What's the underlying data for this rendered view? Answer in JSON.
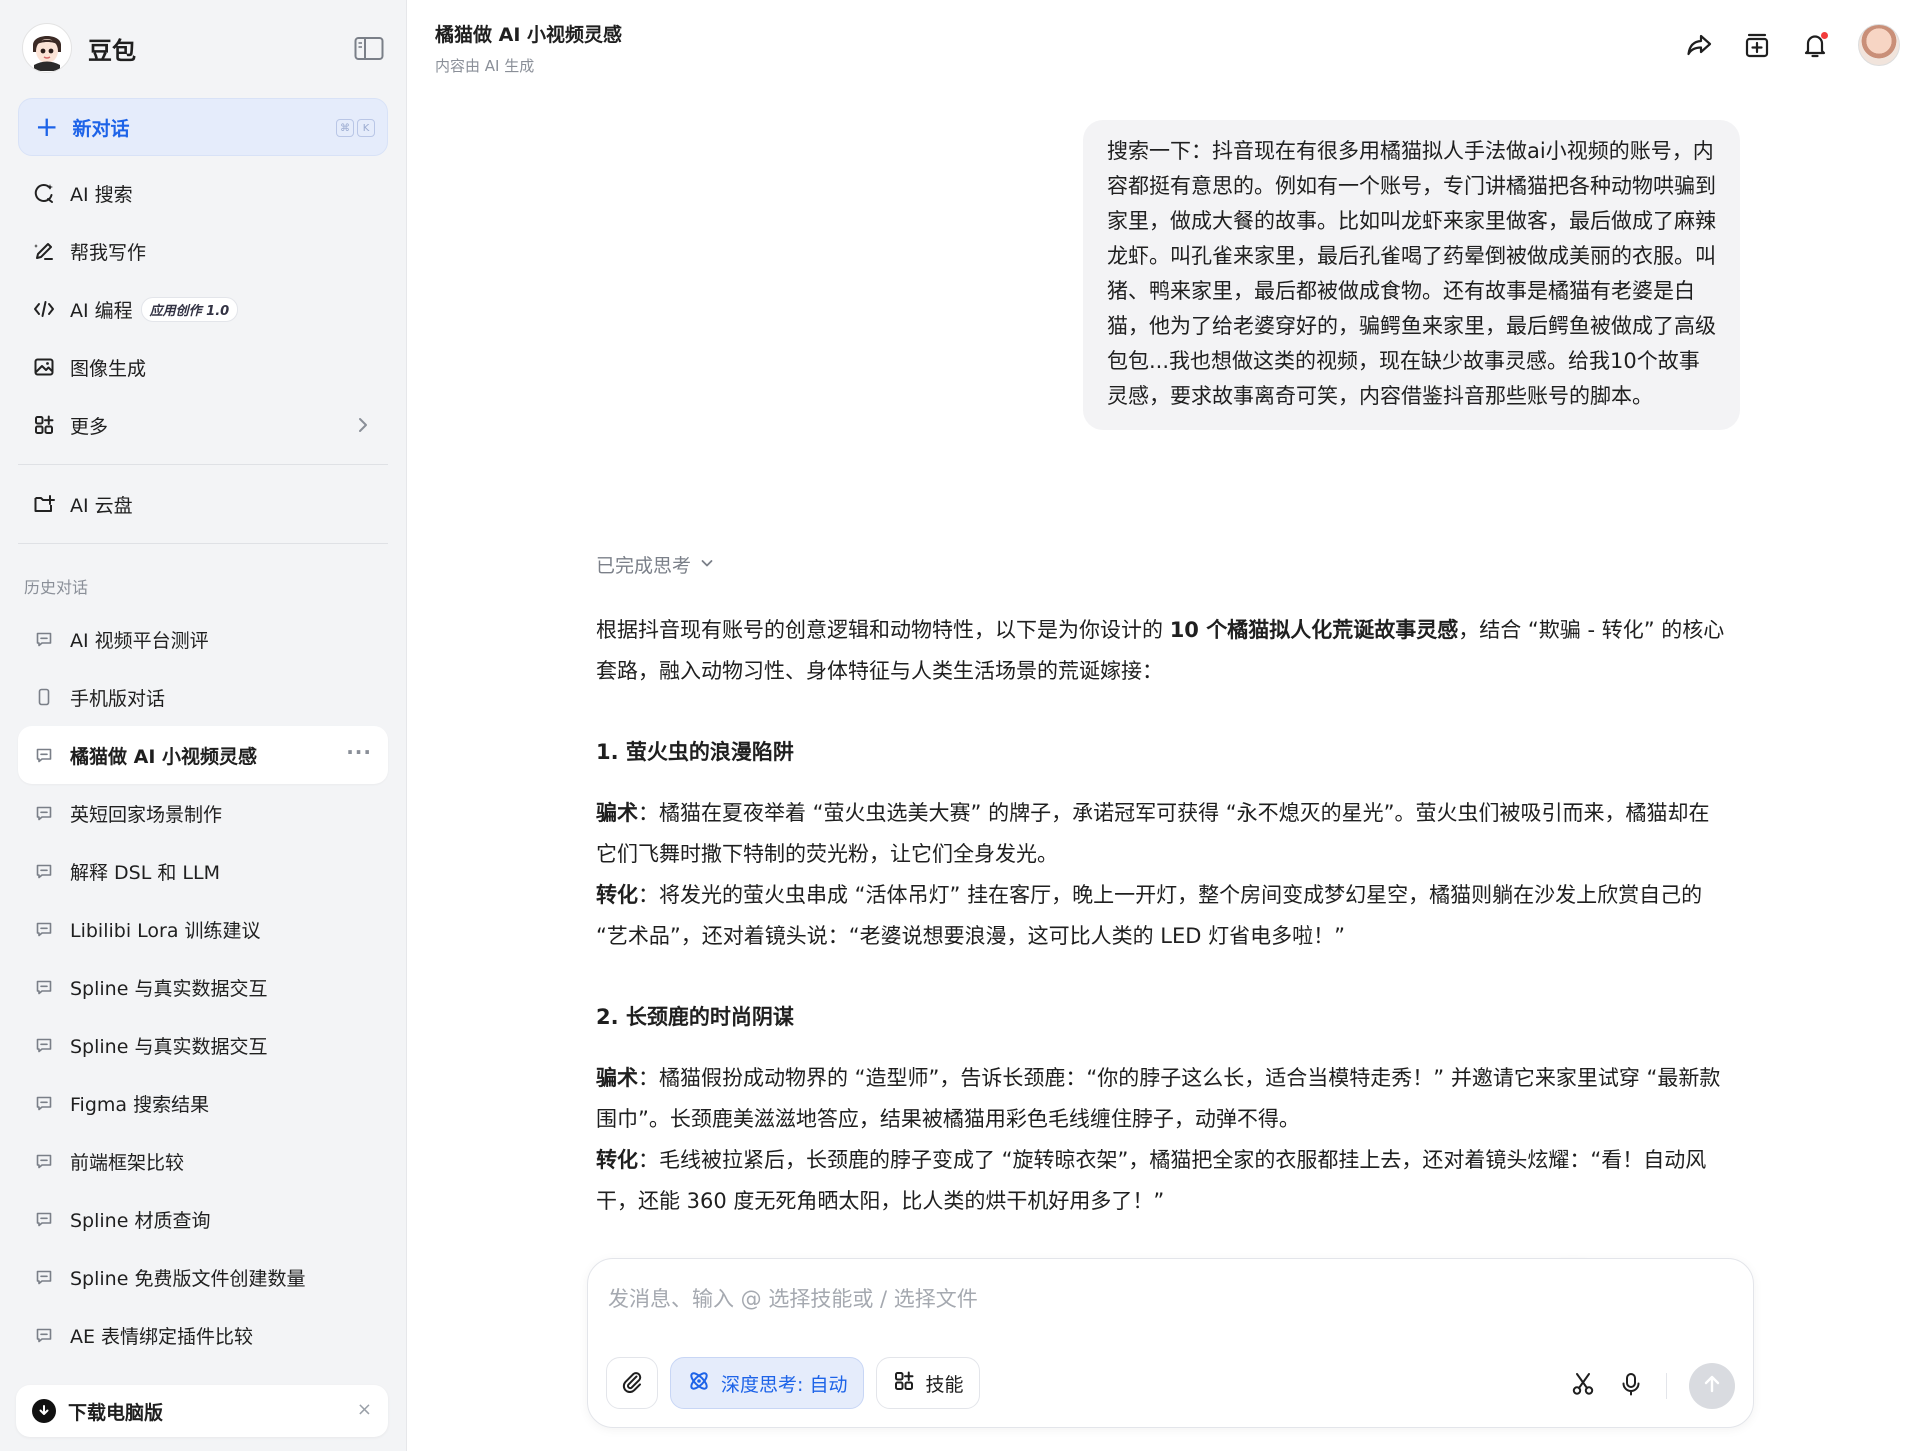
{
  "app": {
    "name": "豆包"
  },
  "sidebar": {
    "new_chat": {
      "label": "新对话",
      "shortcut": [
        "⌘",
        "K"
      ]
    },
    "nav": [
      {
        "label": "AI 搜索",
        "icon": "ai-search-icon"
      },
      {
        "label": "帮我写作",
        "icon": "pen-icon"
      },
      {
        "label": "AI 编程",
        "icon": "code-icon",
        "badge": "应用创作 1.0"
      },
      {
        "label": "图像生成",
        "icon": "image-icon"
      },
      {
        "label": "更多",
        "icon": "grid-icon"
      }
    ],
    "cloud": {
      "label": "AI 云盘"
    },
    "history_title": "历史对话",
    "history": [
      {
        "label": "AI 视频平台测评"
      },
      {
        "label": "手机版对话"
      },
      {
        "label": "橘猫做 AI 小视频灵感",
        "active": true,
        "more": "···"
      },
      {
        "label": "英短回家场景制作"
      },
      {
        "label": "解释 DSL 和 LLM"
      },
      {
        "label": "Libilibi Lora 训练建议"
      },
      {
        "label": "Spline 与真实数据交互"
      },
      {
        "label": "Spline 与真实数据交互"
      },
      {
        "label": "Figma 搜索结果"
      },
      {
        "label": "前端框架比较"
      },
      {
        "label": "Spline 材质查询"
      },
      {
        "label": "Spline 免费版文件创建数量"
      },
      {
        "label": "AE 表情绑定插件比较"
      }
    ],
    "download": {
      "label": "下载电脑版",
      "close": "×"
    }
  },
  "header": {
    "title": "橘猫做 AI 小视频灵感",
    "subtitle": "内容由 AI 生成"
  },
  "chat": {
    "user_message": "搜索一下：抖音现在有很多用橘猫拟人手法做ai小视频的账号，内容都挺有意思的。例如有一个账号，专门讲橘猫把各种动物哄骗到家里，做成大餐的故事。比如叫龙虾来家里做客，最后做成了麻辣龙虾。叫孔雀来家里，最后孔雀喝了药晕倒被做成美丽的衣服。叫猪、鸭来家里，最后都被做成食物。还有故事是橘猫有老婆是白猫，他为了给老婆穿好的，骗鳄鱼来家里，最后鳄鱼被做成了高级包包...我也想做这类的视频，现在缺少故事灵感。给我10个故事灵感，要求故事离奇可笑，内容借鉴抖音那些账号的脚本。",
    "thinking_label": "已完成思考",
    "intro_prefix": "根据抖音现有账号的创意逻辑和动物特性，以下是为你设计的 ",
    "intro_bold": "10 个橘猫拟人化荒诞故事灵感",
    "intro_suffix": "，结合 “欺骗 - 转化” 的核心套路，融入动物习性、身体特征与人类生活场景的荒诞嫁接：",
    "stories": [
      {
        "title": "1. 萤火虫的浪漫陷阱",
        "scam_label": "骗术",
        "scam": "：橘猫在夏夜举着 “萤火虫选美大赛” 的牌子，承诺冠军可获得 “永不熄灭的星光”。萤火虫们被吸引而来，橘猫却在它们飞舞时撒下特制的荧光粉，让它们全身发光。",
        "transform_label": "转化",
        "transform": "：将发光的萤火虫串成 “活体吊灯” 挂在客厅，晚上一开灯，整个房间变成梦幻星空，橘猫则躺在沙发上欣赏自己的 “艺术品”，还对着镜头说：“老婆说想要浪漫，这可比人类的 LED 灯省电多啦！”"
      },
      {
        "title": "2. 长颈鹿的时尚阴谋",
        "scam_label": "骗术",
        "scam": "：橘猫假扮成动物界的 “造型师”，告诉长颈鹿：“你的脖子这么长，适合当模特走秀！” 并邀请它来家里试穿 “最新款围巾”。长颈鹿美滋滋地答应，结果被橘猫用彩色毛线缠住脖子，动弹不得。",
        "transform_label": "转化",
        "transform": "：毛线被拉紧后，长颈鹿的脖子变成了 “旋转晾衣架”，橘猫把全家的衣服都挂上去，还对着镜头炫耀：“看！自动风干，还能 360 度无死角晒太阳，比人类的烘干机好用多了！”"
      }
    ]
  },
  "composer": {
    "placeholder": "发消息、输入 @ 选择技能或 / 选择文件",
    "deep_think_label": "深度思考: 自动",
    "skills_label": "技能"
  },
  "colors": {
    "accent": "#1d63e8",
    "sidebar_bg": "#f3f4f6",
    "notify_dot": "#f23c3c"
  }
}
